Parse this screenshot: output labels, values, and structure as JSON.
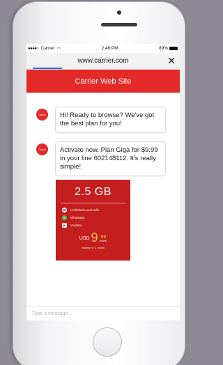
{
  "status_bar": {
    "carrier": "Carrier",
    "time": "2:46 PM",
    "battery": "89%"
  },
  "browser": {
    "url": "www.carrier.com",
    "close_symbol": "✕"
  },
  "site": {
    "title": "Carrier Web Site"
  },
  "chat": {
    "avatar_label": "Carrier",
    "messages": [
      {
        "text": "Hi! Ready to browse? We've got the best plan for you!"
      },
      {
        "text": "Activate now. Plan Giga for $9.99 in your line 602148112. It's really simple!"
      }
    ]
  },
  "plan": {
    "data": "2.5 GB",
    "features": [
      {
        "icon": "phone-icon",
        "label": "Unlimited Local calls"
      },
      {
        "icon": "whatsapp-icon",
        "label": "Whatsapp"
      },
      {
        "icon": "youtube-icon",
        "label": "Youtube"
      }
    ],
    "currency": "USD",
    "price_main": "9",
    "price_cents": ".99",
    "period": "/month",
    "validity": "Validity for 1 month"
  },
  "composer": {
    "placeholder": "Type a message..."
  },
  "colors": {
    "brand_red": "#e32a28",
    "card_red": "#c41e1f",
    "price_yellow": "#f2c94c",
    "url_underline": "#2f6fd6",
    "backdrop": "#8f8a95"
  }
}
